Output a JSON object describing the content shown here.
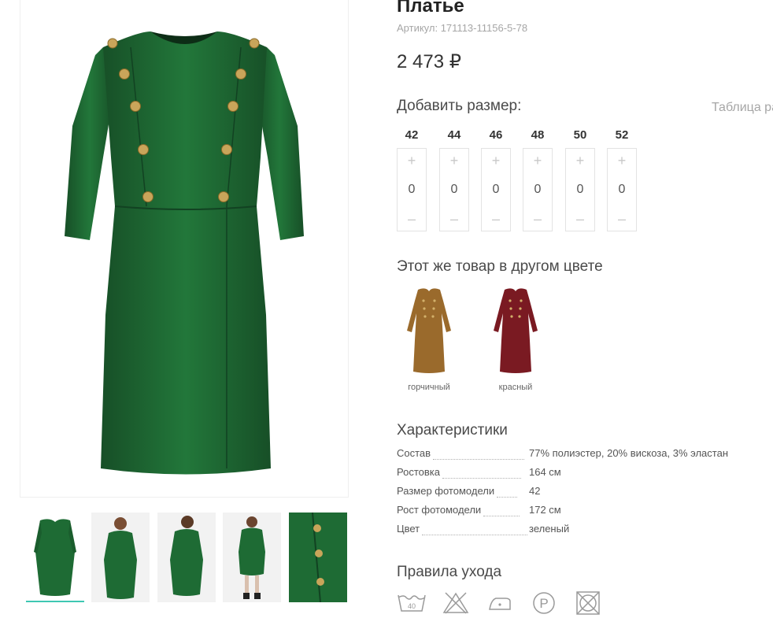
{
  "product": {
    "title": "Платье",
    "sku_label": "Артикул:",
    "sku": "171113-11156-5-78",
    "price": "2 473 ₽"
  },
  "sizes": {
    "title": "Добавить размер:",
    "size_table_link": "Таблица размеров",
    "items": [
      {
        "size": "42",
        "qty": "0",
        "plus": "+",
        "minus": "–"
      },
      {
        "size": "44",
        "qty": "0",
        "plus": "+",
        "minus": "–"
      },
      {
        "size": "46",
        "qty": "0",
        "plus": "+",
        "minus": "–"
      },
      {
        "size": "48",
        "qty": "0",
        "plus": "+",
        "minus": "–"
      },
      {
        "size": "50",
        "qty": "0",
        "plus": "+",
        "minus": "–"
      },
      {
        "size": "52",
        "qty": "0",
        "plus": "+",
        "minus": "–"
      }
    ]
  },
  "other_colors": {
    "title": "Этот же товар в другом цвете",
    "items": [
      {
        "name": "горчичный",
        "color": "#9a6a2c"
      },
      {
        "name": "красный",
        "color": "#7a1a22"
      }
    ]
  },
  "specs": {
    "title": "Характеристики",
    "rows": [
      {
        "key": "Состав",
        "value": "77% полиэстер, 20% вискоза, 3% эластан"
      },
      {
        "key": "Ростовка",
        "value": "164 см"
      },
      {
        "key": "Размер фотомодели",
        "value": "42"
      },
      {
        "key": "Рост фотомодели",
        "value": "172 см"
      },
      {
        "key": "Цвет",
        "value": "зеленый"
      }
    ]
  },
  "care": {
    "title": "Правила ухода",
    "icons": [
      "wash-40-icon",
      "no-bleach-icon",
      "iron-low-icon",
      "dry-clean-p-icon",
      "no-tumble-dry-icon"
    ],
    "wash_temp": "40"
  },
  "gallery": {
    "dress_color": "#1e6b34",
    "accent_color": "#3ec7b2"
  }
}
